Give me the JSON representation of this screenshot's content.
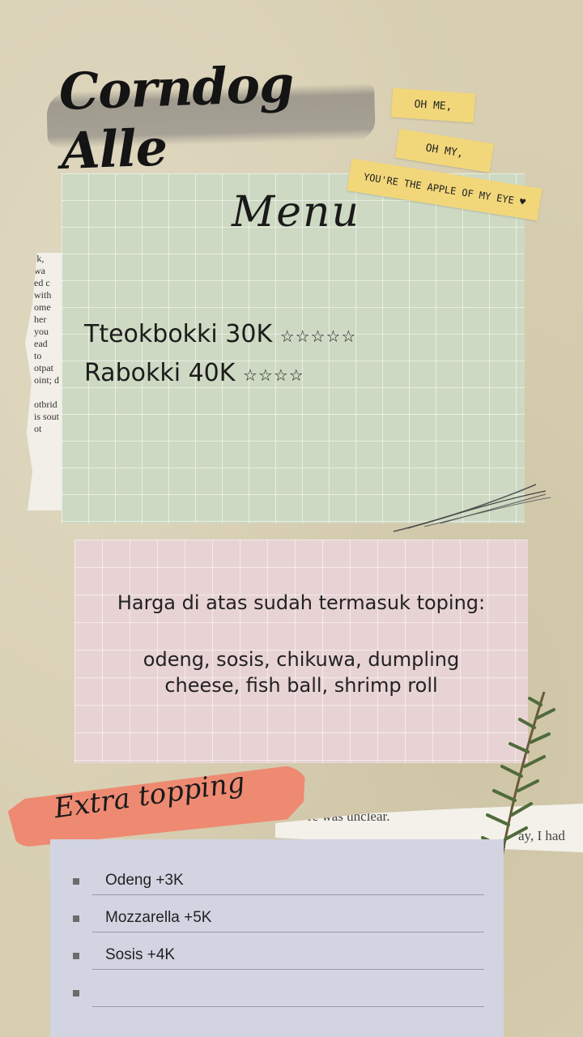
{
  "title": "Corndog Alle",
  "tapes": [
    "OH ME,",
    "OH MY,",
    "YOU'RE THE APPLE OF MY EYE ♥"
  ],
  "torn_page_lines": [
    "ık,",
    "wa",
    "ed c",
    "with",
    "ome",
    "her",
    "you",
    "ead",
    "to",
    "otpat",
    "oint; d",
    "",
    "otbrid",
    "is sout",
    "ot"
  ],
  "menu": {
    "heading": "Menu",
    "items": [
      {
        "text": "Tteokbokki  30K",
        "stars": "☆☆☆☆☆"
      },
      {
        "text": "Rabokki  40K",
        "stars": "☆☆☆☆"
      }
    ]
  },
  "toppings_note": {
    "intro": "Harga di atas sudah termasuk toping:",
    "line1": "odeng, sosis, chikuwa, dumpling",
    "line2": "cheese, fish ball, shrimp roll"
  },
  "extra": {
    "title": "Extra topping",
    "items": [
      "Odeng +3K",
      "Mozzarella +5K",
      "Sosis +4K",
      ""
    ]
  },
  "book_strip": {
    "line1": "re was unclear.",
    "line2": "ay, I had"
  },
  "colors": {
    "menu_card": "#cdd9c2",
    "pink_card": "#e8d3d4",
    "lavender_card": "#d2d4e2",
    "tape": "#f2d77a",
    "brush": "#ee8a72"
  }
}
